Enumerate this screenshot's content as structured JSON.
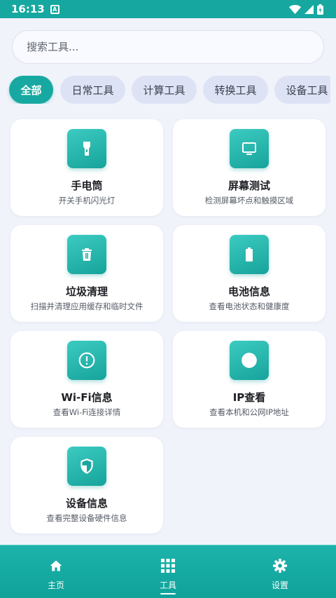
{
  "status_bar": {
    "time": "16:13",
    "notification": "A"
  },
  "search": {
    "placeholder": "搜索工具..."
  },
  "chips": [
    "全部",
    "日常工具",
    "计算工具",
    "转换工具",
    "设备工具"
  ],
  "tools": [
    {
      "title": "手电筒",
      "desc": "开关手机闪光灯",
      "icon": "flashlight-icon"
    },
    {
      "title": "屏幕测试",
      "desc": "检测屏幕坏点和触摸区域",
      "icon": "monitor-icon"
    },
    {
      "title": "垃圾清理",
      "desc": "扫描并清理应用缓存和临时文件",
      "icon": "trash-icon"
    },
    {
      "title": "电池信息",
      "desc": "查看电池状态和健康度",
      "icon": "battery-icon"
    },
    {
      "title": "Wi-Fi信息",
      "desc": "查看Wi-Fi连接详情",
      "icon": "info-icon"
    },
    {
      "title": "IP查看",
      "desc": "查看本机和公网IP地址",
      "icon": "globe-icon"
    },
    {
      "title": "设备信息",
      "desc": "查看完整设备硬件信息",
      "icon": "shield-icon"
    }
  ],
  "nav": [
    {
      "label": "主页",
      "icon": "home-icon"
    },
    {
      "label": "工具",
      "icon": "grid-icon"
    },
    {
      "label": "设置",
      "icon": "gear-icon"
    }
  ],
  "colors": {
    "accent": "#17A9A1",
    "chip_bg": "#DDE3F5",
    "page_bg": "#F1F3FB"
  }
}
